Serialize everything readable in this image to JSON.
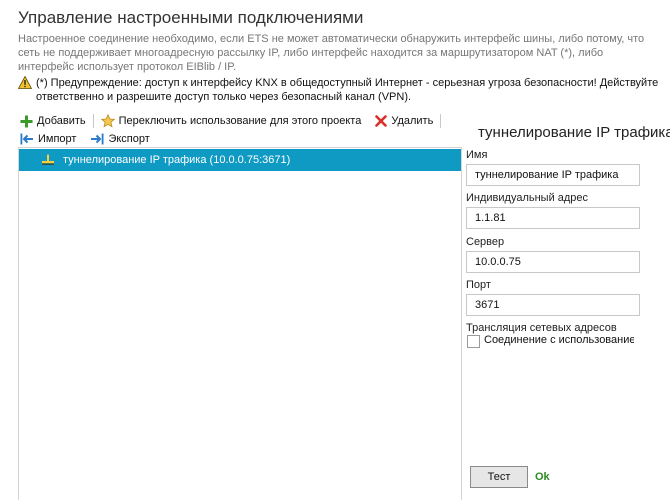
{
  "header": {
    "title": "Управление настроенными подключениями",
    "description": "Настроенное соединение необходимо, если ETS не может автоматически обнаружить интерфейс шины, либо потому, что сеть не поддерживает многоадресную рассылку IP, либо интерфейс находится за маршрутизатором NAT (*), либо интерфейс использует протокол EIBlib / IP.",
    "warning": "(*) Предупреждение: доступ к интерфейсу KNX в общедоступный Интернет - серьезная угроза безопасности! Действуйте ответственно и разрешите доступ только через безопасный канал (VPN)."
  },
  "toolbar": {
    "add_label": "Добавить",
    "toggle_label": "Переключить использование для этого проекта",
    "delete_label": "Удалить",
    "import_label": "Импорт",
    "export_label": "Экспорт"
  },
  "connections": [
    {
      "label": "туннелирование IP трафика (10.0.0.75:3671)"
    }
  ],
  "details": {
    "title": "туннелирование IP трафика",
    "name_label": "Имя",
    "name_value": "туннелирование IP трафика",
    "address_label": "Индивидуальный адрес",
    "address_value": "1.1.81",
    "server_label": "Сервер",
    "server_value": "10.0.0.75",
    "port_label": "Порт",
    "port_value": "3671",
    "nat_label": "Трансляция сетевых адресов",
    "nat_checkbox_label": "Соединение с использованием...",
    "test_label": "Тест",
    "status": "Ok"
  },
  "colors": {
    "selection": "#0f9ac4",
    "ok": "#2e8b23",
    "warning": "#f2c230"
  }
}
